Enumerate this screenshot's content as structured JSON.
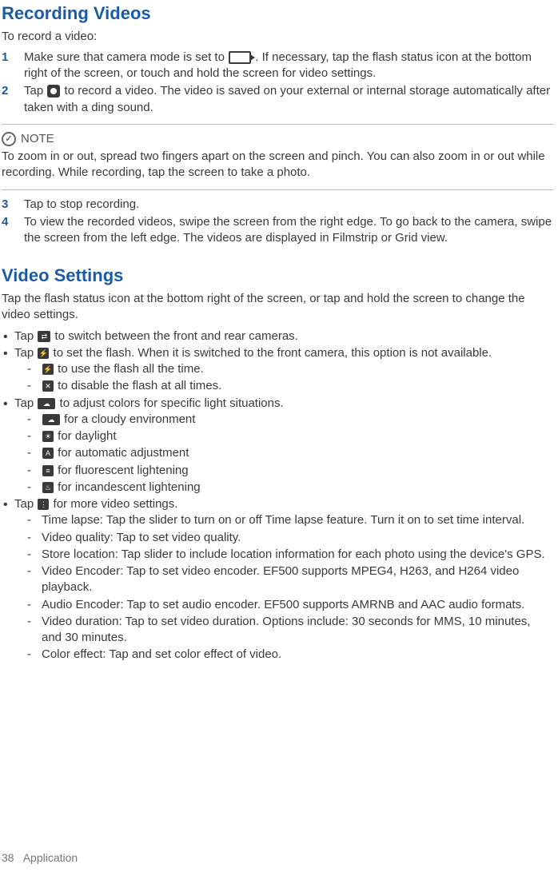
{
  "section1": {
    "title": "Recording Videos",
    "intro": "To record a video:",
    "step1": {
      "num": "1",
      "before": "Make sure that camera mode is set to ",
      "after": ". If necessary, tap the flash status icon at the bottom right of the screen, or touch and hold the screen for video   settings."
    },
    "step2": {
      "num": "2",
      "before": "Tap ",
      "after": " to record a video. The video is saved on your external or internal storage automatically after taken with a ding  sound."
    },
    "note": {
      "label": "NOTE",
      "body": "To zoom in or out, spread two fingers apart on the screen and pinch. You can also zoom in or out while recording. While recording, tap the screen to take a  photo."
    },
    "step3": {
      "num": "3",
      "text": "Tap to stop recording."
    },
    "step4": {
      "num": "4",
      "text": "To view the recorded videos, swipe the screen from the right edge. To go back to the camera, swipe the screen from the left edge. The videos are displayed in Filmstrip or Grid view."
    }
  },
  "section2": {
    "title": "Video Settings",
    "intro": "Tap the flash status icon at the bottom right of the screen, or tap and hold the screen to change the video settings.",
    "b1": {
      "before": "Tap ",
      "after": " to switch between the front and rear  cameras."
    },
    "b2": {
      "before": "Tap ",
      "after": " to set the flash. When it is switched to the front camera, this option is not available."
    },
    "b2a": " to use the flash all the time.",
    "b2b": " to disable the flash at all times.",
    "b3": {
      "before": "Tap ",
      "after": " to adjust colors for specific light situations."
    },
    "b3a": " for a cloudy  environment",
    "b3b": " for daylight",
    "b3c": " for automatic adjustment",
    "b3d": " for fluorescent  lightening",
    "b3e": " for incandescent  lightening",
    "b4": {
      "before": "Tap ",
      "after": " for more video settings."
    },
    "b4a": "Time lapse: Tap the slider to turn on or off Time lapse feature. Turn it on to set time interval.",
    "b4b": "Video quality: Tap to set video quality.",
    "b4c": "Store location: Tap slider to include location information for each photo using the device's GPS.",
    "b4d": "Video Encoder: Tap to set video encoder. EF500 supports MPEG4, H263, and H264 video playback.",
    "b4e": "Audio Encoder: Tap to set audio encoder. EF500 supports AMRNB and AAC audio formats.",
    "b4f": "Video duration: Tap to set video duration. Options include: 30 seconds for MMS, 10 minutes, and 30 minutes.",
    "b4g": "Color effect: Tap and set color effect of video."
  },
  "footer": {
    "page": "38",
    "label": "Application"
  }
}
